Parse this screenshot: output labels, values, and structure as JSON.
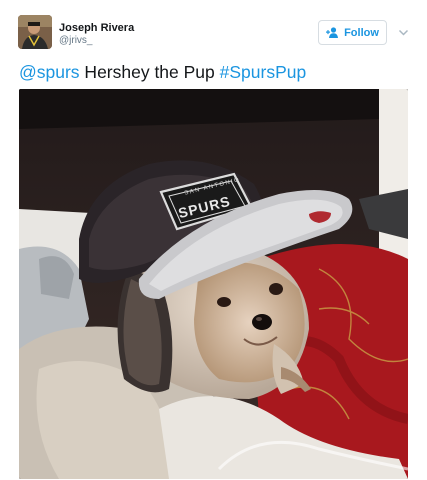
{
  "tweet": {
    "author": {
      "name": "Joseph Rivera",
      "handle": "@jrivs_",
      "avatar_icon": "user-avatar-photo"
    },
    "follow_label": "Follow",
    "text": {
      "mention": "@spurs",
      "body": " Hershey the Pup ",
      "hashtag": "#SpursPup"
    },
    "photo": {
      "subject": "shih tzu dog wearing a San Antonio Spurs snapback cap lying on a red blanket",
      "cap_text": "SAN ANTONIO SPURS"
    }
  },
  "colors": {
    "link": "#1b95e0",
    "name": "#14171a",
    "handle": "#657786",
    "border": "#d7dde2"
  }
}
